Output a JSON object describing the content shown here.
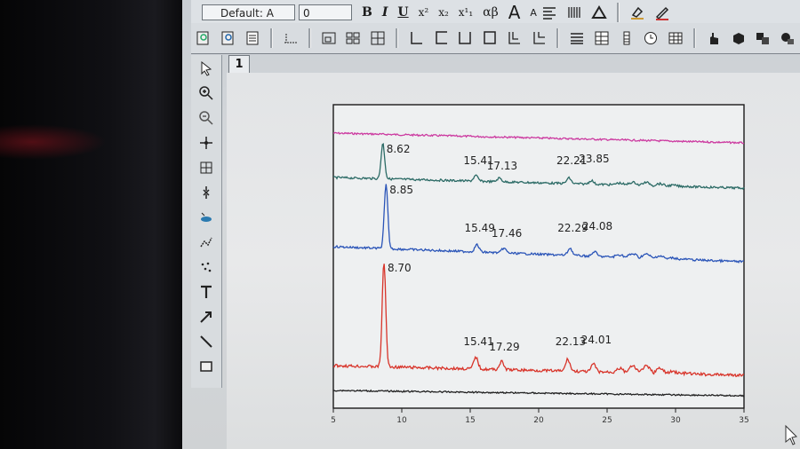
{
  "toolbar": {
    "font_name": "Default: A",
    "font_size": "0",
    "bold": "B",
    "italic": "I",
    "underline": "U",
    "superscript": "x²",
    "subscript": "x₂",
    "supsub": "x¹₁",
    "greek": "αβ",
    "bigger": "A",
    "smaller": "A"
  },
  "layer": {
    "number": "1"
  },
  "chart_data": {
    "type": "line",
    "xlim": [
      5,
      35
    ],
    "x_ticks": [
      "5",
      "10",
      "15",
      "20",
      "25",
      "30",
      "35"
    ],
    "series": [
      {
        "color": "#cc3aa0",
        "peaks": [],
        "labels": []
      },
      {
        "color": "#2c6b66",
        "peaks": [
          8.62,
          15.41,
          17.13,
          22.21,
          23.85
        ],
        "labels": [
          "8.62",
          "15.41",
          "17.13",
          "22.21",
          "23.85"
        ]
      },
      {
        "color": "#2b55b8",
        "peaks": [
          8.85,
          15.49,
          17.46,
          22.29,
          24.08
        ],
        "labels": [
          "8.85",
          "15.49",
          "17.46",
          "22.29",
          "24.08"
        ]
      },
      {
        "color": "#d8342a",
        "peaks": [
          8.7,
          15.41,
          17.29,
          22.13,
          24.01
        ],
        "labels": [
          "8.70",
          "15.41",
          "17.29",
          "22.13",
          "24.01"
        ]
      },
      {
        "color": "#222222",
        "peaks": [],
        "labels": []
      }
    ]
  },
  "colors": {
    "screen_bg": "#d6d9dc",
    "plot_frame": "#1a1a1a"
  }
}
